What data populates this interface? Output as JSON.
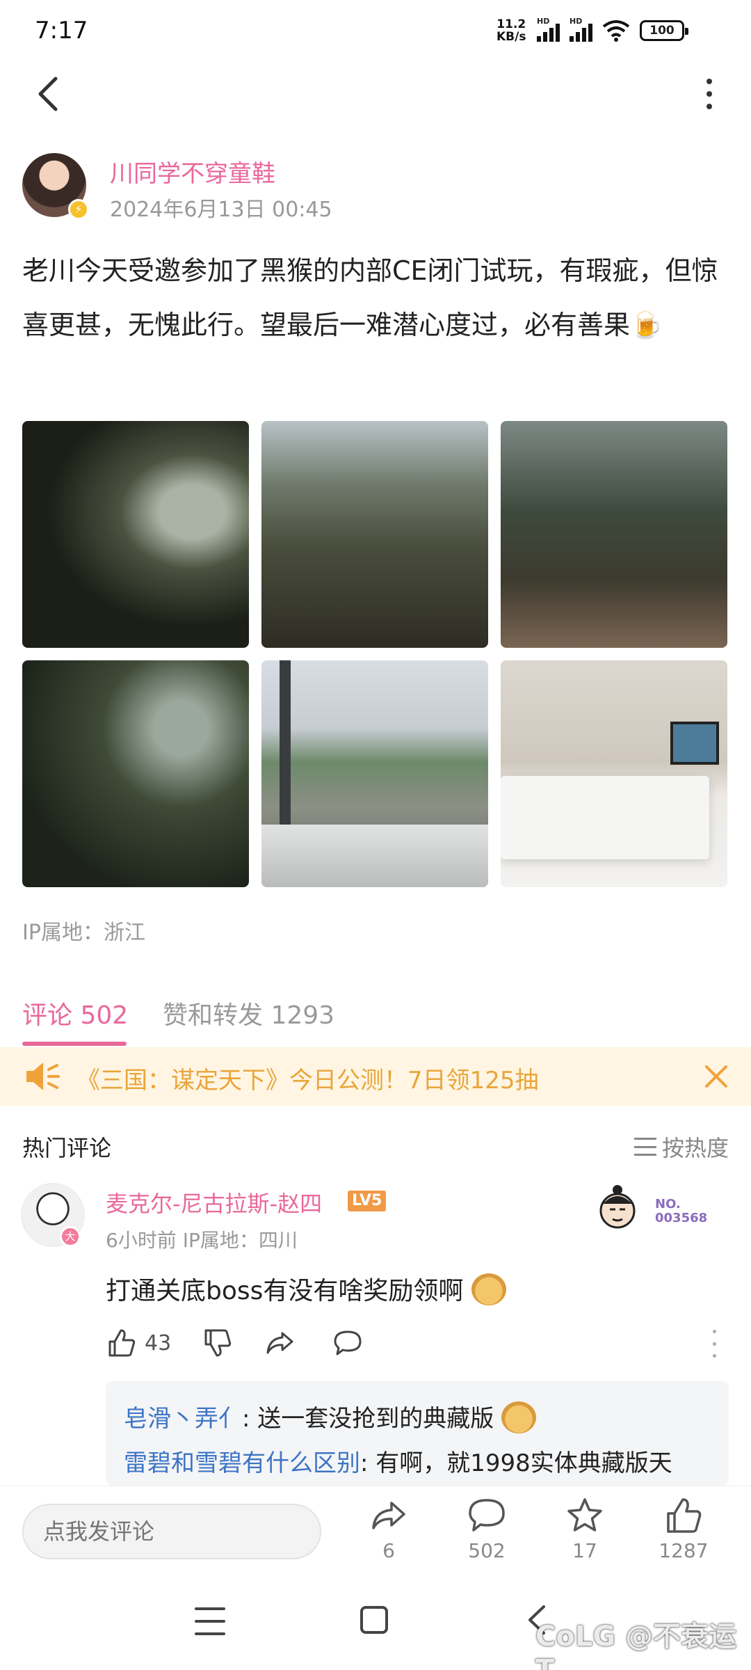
{
  "status_bar": {
    "time": "7:17",
    "net_speed_value": "11.2",
    "net_speed_unit": "KB/s",
    "hd1": "HD",
    "hd2": "HD",
    "battery": "100"
  },
  "post": {
    "author": "川同学不穿童鞋",
    "timestamp": "2024年6月13日 00:45",
    "text": "老川今天受邀参加了黑猴的内部CE闭门试玩，有瑕疵，但惊喜更甚，无愧此行。望最后一难潜心度过，必有善果🍺",
    "ip_location": "IP属地：浙江"
  },
  "tabs": {
    "comments": "评论 502",
    "likes_shares": "赞和转发 1293"
  },
  "ad": {
    "text": "《三国：谋定天下》今日公测！7日领125抽"
  },
  "hot_comments": {
    "title": "热门评论",
    "sort_label": "按热度"
  },
  "comment": {
    "user": "麦克尔-尼古拉斯-赵四",
    "level": "LV5",
    "meta": "6小时前  IP属地：四川",
    "badge_no_label": "NO.",
    "badge_no_value": "003568",
    "avatar_badge": "大",
    "text": "打通关底boss有没有啥奖励领啊",
    "likes": "43",
    "replies": [
      {
        "name": "皂滑丶弄亻",
        "text": ": 送一套没抢到的典藏版"
      },
      {
        "name": "雷碧和雪碧有什么区别",
        "text": ": 有啊，就1998实体典藏版天"
      }
    ]
  },
  "bottom_bar": {
    "input_placeholder": "点我发评论",
    "share_count": "6",
    "comment_count": "502",
    "favorite_count": "17",
    "like_count": "1287"
  },
  "watermark": "CoLG @不衰运T",
  "colors": {
    "accent": "#e9689a",
    "link": "#3d74c4",
    "ad_text": "#e9a53b",
    "ad_bg": "#fff5e2"
  },
  "icons": [
    "back-icon",
    "more-icon",
    "speaker-icon",
    "close-icon",
    "sort-icon",
    "thumb-up-icon",
    "thumb-down-icon",
    "share-icon",
    "comment-icon",
    "star-icon",
    "menu-icon",
    "home-icon",
    "nav-back-icon"
  ]
}
